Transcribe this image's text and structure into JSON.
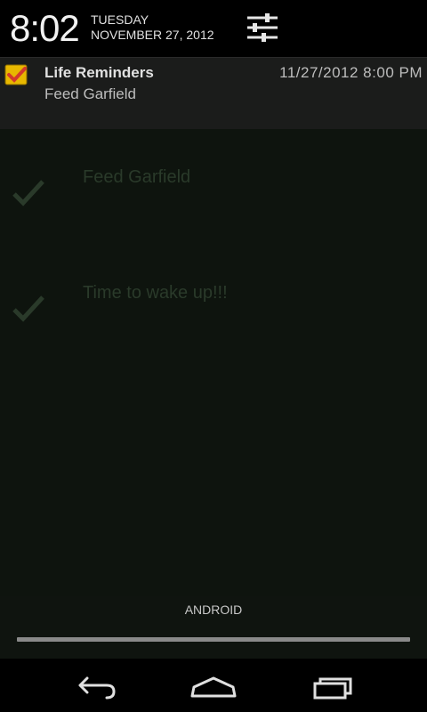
{
  "status": {
    "time": "8:02",
    "day": "TUESDAY",
    "date": "NOVEMBER 27, 2012"
  },
  "notification": {
    "app_name": "Life Reminders",
    "timestamp": "11/27/2012 8:00 PM",
    "text": "Feed Garfield"
  },
  "background_app": {
    "items": [
      {
        "text": "Feed Garfield"
      },
      {
        "text": "Time to wake up!!!"
      }
    ]
  },
  "carrier": "ANDROID",
  "colors": {
    "accent_icon": "#e8b800",
    "check_red": "#d33a2c"
  },
  "icons": {
    "settings": "quick-settings-sliders-icon",
    "back": "back-arrow-icon",
    "home": "home-icon",
    "recents": "recent-apps-icon"
  }
}
